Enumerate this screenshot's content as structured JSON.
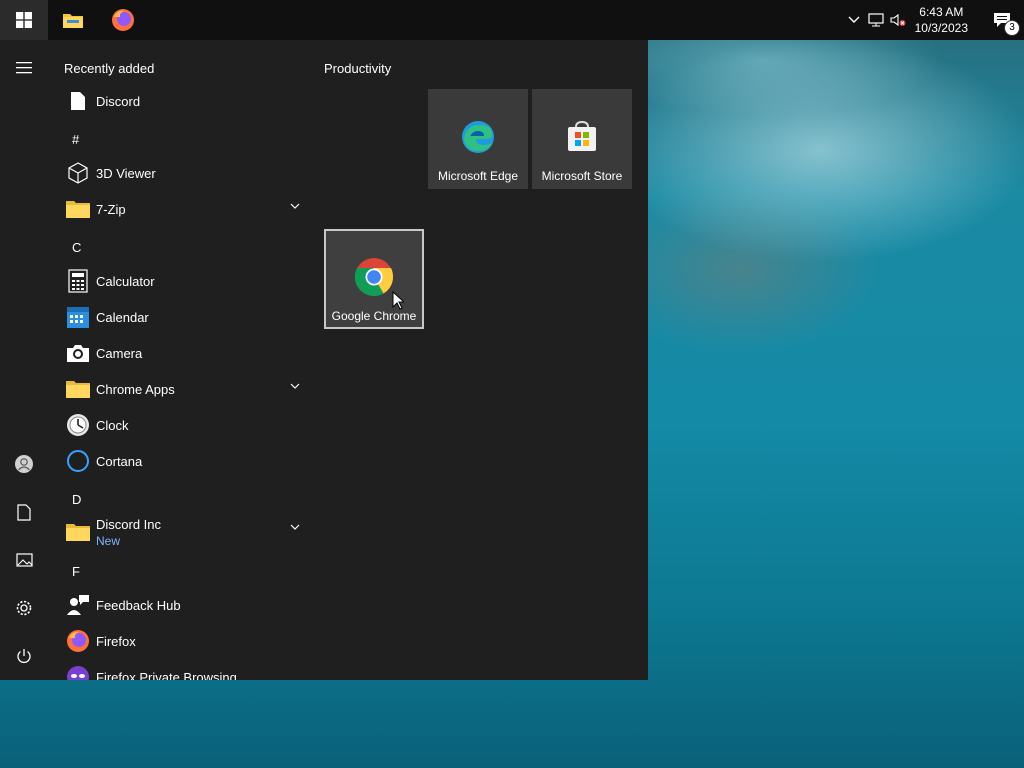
{
  "taskbar": {
    "apps": [
      {
        "name": "File Explorer",
        "icon": "folder-icon"
      },
      {
        "name": "Firefox",
        "icon": "firefox-icon"
      }
    ],
    "clock": {
      "time": "6:43 AM",
      "date": "10/3/2023"
    },
    "notifications": {
      "count": "3"
    }
  },
  "start_menu": {
    "recently_added_header": "Recently added",
    "tiles_group_header": "Productivity",
    "apps": [
      {
        "label": "Discord",
        "icon": "document-icon"
      },
      {
        "section": "#"
      },
      {
        "label": "3D Viewer",
        "icon": "cube-icon"
      },
      {
        "label": "7-Zip",
        "icon": "folder-icon",
        "expandable": true
      },
      {
        "section": "C"
      },
      {
        "label": "Calculator",
        "icon": "calculator-icon"
      },
      {
        "label": "Calendar",
        "icon": "calendar-icon"
      },
      {
        "label": "Camera",
        "icon": "camera-icon"
      },
      {
        "label": "Chrome Apps",
        "icon": "folder-icon",
        "expandable": true
      },
      {
        "label": "Clock",
        "icon": "clock-icon"
      },
      {
        "label": "Cortana",
        "icon": "cortana-icon"
      },
      {
        "section": "D"
      },
      {
        "label": "Discord Inc",
        "sublabel": "New",
        "icon": "folder-icon",
        "expandable": true
      },
      {
        "section": "F"
      },
      {
        "label": "Feedback Hub",
        "icon": "feedback-icon"
      },
      {
        "label": "Firefox",
        "icon": "firefox-icon"
      },
      {
        "label": "Firefox Private Browsing",
        "icon": "firefox-private-icon"
      }
    ],
    "tiles": [
      {
        "label": "Microsoft Edge",
        "icon": "edge-icon"
      },
      {
        "label": "Microsoft Store",
        "icon": "store-icon"
      },
      {
        "label": "Google Chrome",
        "icon": "chrome-icon",
        "selected": true
      }
    ],
    "rail": [
      "menu-icon",
      "user-icon",
      "documents-icon",
      "pictures-icon",
      "settings-icon",
      "power-icon"
    ]
  },
  "colors": {
    "menu_bg": "#1f1f1f",
    "tile_bg": "#3a3a3a",
    "taskbar_bg": "#101010",
    "accent_new": "#7fb3ff"
  }
}
